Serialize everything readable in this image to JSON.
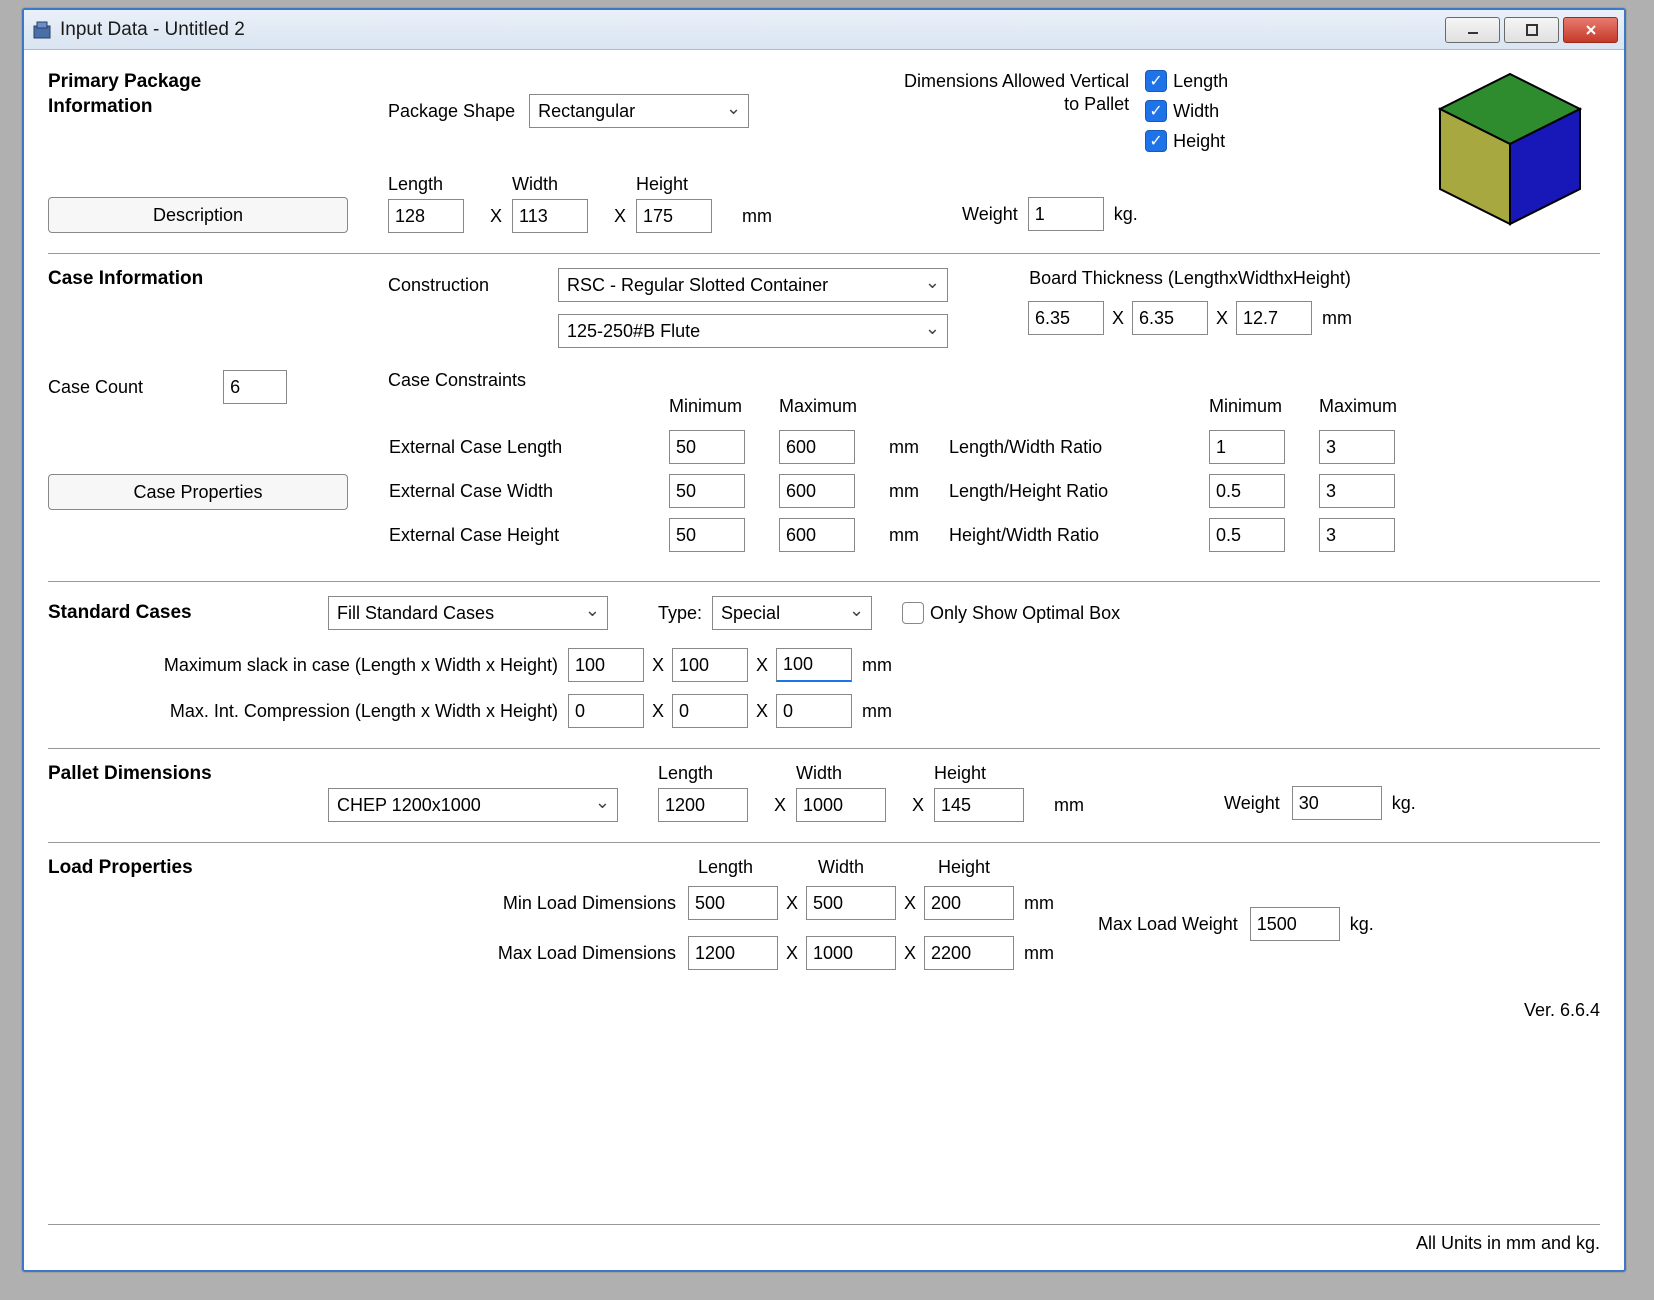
{
  "window": {
    "title": "Input Data - Untitled 2"
  },
  "primary": {
    "heading": "Primary Package Information",
    "shape_label": "Package Shape",
    "shape_value": "Rectangular",
    "description_btn": "Description",
    "length_label": "Length",
    "width_label": "Width",
    "height_label": "Height",
    "length": "128",
    "width": "113",
    "height": "175",
    "unit": "mm",
    "dims_allowed_label": "Dimensions Allowed Vertical to Pallet",
    "dim_length_label": "Length",
    "dim_width_label": "Width",
    "dim_height_label": "Height",
    "weight_label": "Weight",
    "weight": "1",
    "weight_unit": "kg."
  },
  "case": {
    "heading": "Case Information",
    "construction_label": "Construction",
    "construction_value": "RSC - Regular Slotted Container",
    "flute_value": "125-250#B Flute",
    "board_thick_label": "Board Thickness (LengthxWidthxHeight)",
    "board_l": "6.35",
    "board_w": "6.35",
    "board_h": "12.7",
    "board_unit": "mm",
    "count_label": "Case Count",
    "count": "6",
    "constraints_label": "Case Constraints",
    "min_label": "Minimum",
    "max_label": "Maximum",
    "ext_len_label": "External Case Length",
    "ext_wid_label": "External Case Width",
    "ext_hei_label": "External Case Height",
    "ext_len_min": "50",
    "ext_len_max": "600",
    "ext_wid_min": "50",
    "ext_wid_max": "600",
    "ext_hei_min": "50",
    "ext_hei_max": "600",
    "mm": "mm",
    "lw_ratio_label": "Length/Width Ratio",
    "lh_ratio_label": "Length/Height Ratio",
    "hw_ratio_label": "Height/Width Ratio",
    "lw_min": "1",
    "lw_max": "3",
    "lh_min": "0.5",
    "lh_max": "3",
    "hw_min": "0.5",
    "hw_max": "3",
    "props_btn": "Case Properties"
  },
  "standard": {
    "heading": "Standard Cases",
    "fill_value": "Fill Standard Cases",
    "type_label": "Type:",
    "type_value": "Special",
    "only_optimal_label": "Only Show Optimal Box",
    "slack_label": "Maximum slack in case  (Length x Width x Height)",
    "slack_l": "100",
    "slack_w": "100",
    "slack_h": "100",
    "comp_label": "Max. Int. Compression (Length x Width x Height)",
    "comp_l": "0",
    "comp_w": "0",
    "comp_h": "0",
    "mm": "mm"
  },
  "pallet": {
    "heading": "Pallet Dimensions",
    "select_value": "CHEP 1200x1000",
    "length_label": "Length",
    "width_label": "Width",
    "height_label": "Height",
    "length": "1200",
    "width": "1000",
    "height": "145",
    "mm": "mm",
    "weight_label": "Weight",
    "weight": "30",
    "weight_unit": "kg."
  },
  "load": {
    "heading": "Load Properties",
    "length_label": "Length",
    "width_label": "Width",
    "height_label": "Height",
    "min_label": "Min Load Dimensions",
    "max_label": "Max Load Dimensions",
    "min_l": "500",
    "min_w": "500",
    "min_h": "200",
    "max_l": "1200",
    "max_w": "1000",
    "max_h": "2200",
    "mm": "mm",
    "max_weight_label": "Max Load Weight",
    "max_weight": "1500",
    "weight_unit": "kg."
  },
  "version": "Ver. 6.6.4",
  "footer": "All Units in mm and kg."
}
